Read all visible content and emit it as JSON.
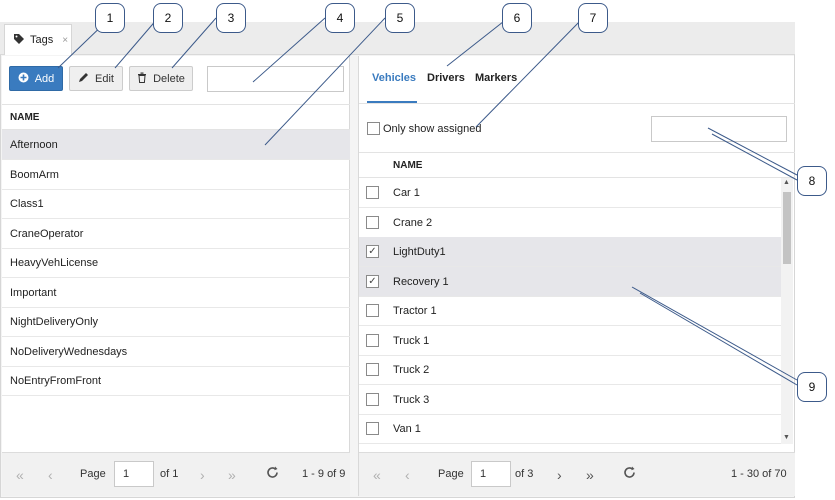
{
  "tabs": {
    "tags_label": "Tags",
    "close_glyph": "×"
  },
  "left": {
    "add_label": "Add",
    "edit_label": "Edit",
    "delete_label": "Delete",
    "column_header": "NAME",
    "rows": [
      "Afternoon",
      "BoomArm",
      "Class1",
      "CraneOperator",
      "HeavyVehLicense",
      "Important",
      "NightDeliveryOnly",
      "NoDeliveryWednesdays",
      "NoEntryFromFront"
    ],
    "selected_row": "Afternoon",
    "pager": {
      "page_label": "Page",
      "page_value": "1",
      "of_label": "of 1",
      "range": "1 - 9 of 9"
    }
  },
  "right": {
    "tabs": [
      "Vehicles",
      "Drivers",
      "Markers"
    ],
    "active_tab": "Vehicles",
    "only_assigned_label": "Only show assigned",
    "column_header": "NAME",
    "rows": [
      {
        "name": "Car 1",
        "checked": false
      },
      {
        "name": "Crane 2",
        "checked": false
      },
      {
        "name": "LightDuty1",
        "checked": true
      },
      {
        "name": "Recovery 1",
        "checked": true
      },
      {
        "name": "Tractor 1",
        "checked": false
      },
      {
        "name": "Truck 1",
        "checked": false
      },
      {
        "name": "Truck 2",
        "checked": false
      },
      {
        "name": "Truck 3",
        "checked": false
      },
      {
        "name": "Van 1",
        "checked": false
      }
    ],
    "pager": {
      "page_label": "Page",
      "page_value": "1",
      "of_label": "of 3",
      "range": "1 - 30 of 70"
    }
  },
  "callouts": [
    "1",
    "2",
    "3",
    "4",
    "5",
    "6",
    "7",
    "8",
    "9"
  ],
  "colors": {
    "accent": "#3a7bbf",
    "selected_row": "#e6e6ea",
    "callout_border": "#3c5a8a"
  },
  "icons": {
    "tag": "tag-icon",
    "add": "plus-circle-icon",
    "edit": "pencil-icon",
    "delete": "trash-icon",
    "first": "double-chevron-left-icon",
    "prev": "chevron-left-icon",
    "next": "chevron-right-icon",
    "last": "double-chevron-right-icon",
    "refresh": "refresh-icon",
    "check": "check-icon"
  }
}
